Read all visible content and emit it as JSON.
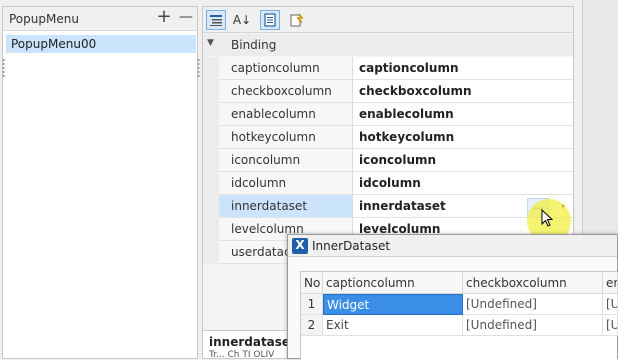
{
  "left_panel": {
    "title": "PopupMenu",
    "add_label": "+",
    "remove_label": "—",
    "items": [
      "PopupMenu00"
    ]
  },
  "toolbar": {
    "categorized_icon": "categorized-icon",
    "sort_icon": "sort-az-icon",
    "pages_icon": "property-pages-icon",
    "events_icon": "events-icon",
    "sort_label": "A↓"
  },
  "property_grid": {
    "category": "Binding",
    "rows": [
      {
        "name": "captioncolumn",
        "value": "captioncolumn"
      },
      {
        "name": "checkboxcolumn",
        "value": "checkboxcolumn"
      },
      {
        "name": "enablecolumn",
        "value": "enablecolumn"
      },
      {
        "name": "hotkeycolumn",
        "value": "hotkeycolumn"
      },
      {
        "name": "iconcolumn",
        "value": "iconcolumn"
      },
      {
        "name": "idcolumn",
        "value": "idcolumn"
      },
      {
        "name": "innerdataset",
        "value": "innerdataset"
      },
      {
        "name": "levelcolumn",
        "value": "levelcolumn"
      },
      {
        "name": "userdataco",
        "value": ""
      }
    ],
    "ellipsis_label": "...",
    "dropdown_label": "▾"
  },
  "description": {
    "title": "innerdataset",
    "text": "Tr... Ch TI OLIV"
  },
  "dialog": {
    "title": "InnerDataset",
    "headers": [
      "No",
      "captioncolumn",
      "checkboxcolumn",
      "er"
    ],
    "rows": [
      {
        "no": "1",
        "caption": "Widget",
        "checkbox": "[Undefined]",
        "extra": "[U"
      },
      {
        "no": "2",
        "caption": "Exit",
        "checkbox": "[Undefined]",
        "extra": "[U"
      }
    ]
  },
  "colors": {
    "selection": "#cce4fb",
    "cell_selected": "#3a8ee6",
    "cursor_halo": "#f0f03c",
    "dialog_icon": "#1f5faa"
  }
}
